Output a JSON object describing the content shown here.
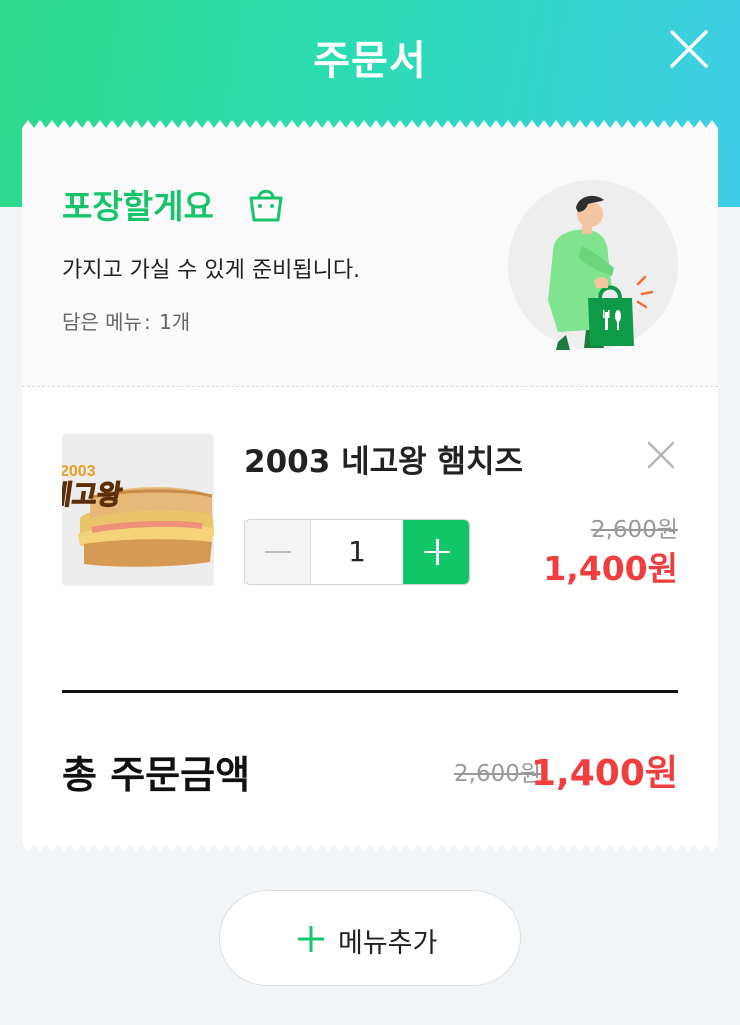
{
  "header": {
    "title": "주문서",
    "close_icon": "close-icon"
  },
  "packing": {
    "title": "포장할게요",
    "icon": "shopping-bag-icon",
    "description": "가지고 가실 수 있게 준비됩니다.",
    "menu_count_label": "담은 메뉴",
    "menu_count_value": "1개",
    "illustration": "person-carrying-bag-illustration"
  },
  "cart": {
    "items": [
      {
        "thumb_logo_year": "2003",
        "thumb_logo_text": "네고왕",
        "name": "2003 네고왕 햄치즈",
        "quantity": "1",
        "original_price": "2,600원",
        "sale_price": "1,400원",
        "remove_icon": "close-icon"
      }
    ]
  },
  "total": {
    "label": "총 주문금액",
    "original_price": "2,600원",
    "sale_price": "1,400원"
  },
  "add_menu": {
    "label": "메뉴추가",
    "icon": "plus-icon"
  },
  "colors": {
    "accent_green": "#12c76a",
    "sale_red": "#f03e3e",
    "header_gradient_start": "#2fd88a",
    "header_gradient_end": "#3ecde8"
  }
}
